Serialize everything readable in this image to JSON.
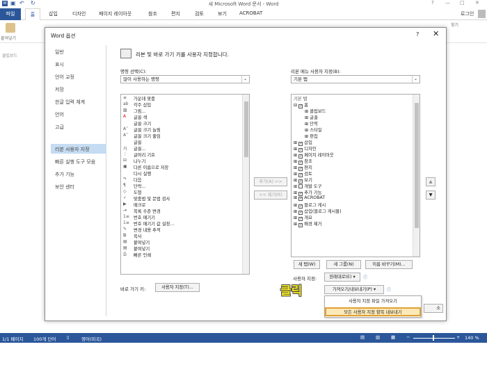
{
  "window": {
    "title": "새 Microsoft Word 문서 - Word",
    "window_controls": [
      "?",
      "—",
      "□",
      "✕"
    ],
    "user": "로그인"
  },
  "ribbon": {
    "tabs": [
      "파일",
      "홈",
      "삽입",
      "디자인",
      "페이지 레이아웃",
      "참조",
      "편지",
      "검토",
      "보기",
      "ACROBAT"
    ],
    "paste": "붙여넣기",
    "clipboard": "클립보드",
    "find": "찾기"
  },
  "dialog": {
    "title": "Word 옵션",
    "help": "?",
    "close": "✕",
    "nav": [
      "일반",
      "표시",
      "언어 교정",
      "저장",
      "한글 입력 체계",
      "언어",
      "고급",
      "리본 사용자 지정",
      "빠른 실행 도구 모음",
      "추가 기능",
      "보안 센터"
    ],
    "selected_nav": "리본 사용자 지정",
    "heading": "리본 및 바로 가기 키를 사용자 지정합니다.",
    "commands_label": "명령 선택(C):",
    "commands_value": "많이 사용하는 명령",
    "ribbon_label": "리본 메뉴 사용자 지정(B):",
    "ribbon_value": "기본 탭",
    "commands": [
      "가운데 맞춤",
      "각주 삽입",
      "그림...",
      "글꼴 색",
      "글꼴 크기",
      "글꼴 크기 늘림",
      "글꼴 크기 줄임",
      "글꼴",
      "글꼴...",
      "글머리 기호",
      "나누기",
      "다른 이름으로 저장",
      "다시 실행",
      "다음",
      "단락...",
      "도형",
      "맞춤법 및 문법 검사",
      "매크로",
      "목록 수준 변경",
      "번호 매기기",
      "번호 매기기 값 설정...",
      "변경 내용 추적",
      "복사",
      "붙여넣기",
      "붙여넣기",
      "빠른 인쇄"
    ],
    "add_button": "추가(A) >>",
    "remove_button": "<< 제거(R)",
    "tree_header": "기본 탭",
    "tree": [
      {
        "label": "홈",
        "indent": 0,
        "check": true,
        "expand": "⊟"
      },
      {
        "label": "클립보드",
        "indent": 2,
        "check": false,
        "expand": "⊞"
      },
      {
        "label": "글꼴",
        "indent": 2,
        "check": false,
        "expand": "⊞"
      },
      {
        "label": "단락",
        "indent": 2,
        "check": false,
        "expand": "⊞"
      },
      {
        "label": "스타일",
        "indent": 2,
        "check": false,
        "expand": "⊞"
      },
      {
        "label": "편집",
        "indent": 2,
        "check": false,
        "expand": "⊞"
      },
      {
        "label": "삽입",
        "indent": 0,
        "check": true,
        "expand": "⊞"
      },
      {
        "label": "디자인",
        "indent": 0,
        "check": true,
        "expand": "⊞"
      },
      {
        "label": "페이지 레이아웃",
        "indent": 0,
        "check": true,
        "expand": "⊞"
      },
      {
        "label": "참조",
        "indent": 0,
        "check": true,
        "expand": "⊞"
      },
      {
        "label": "편지",
        "indent": 0,
        "check": true,
        "expand": "⊞"
      },
      {
        "label": "검토",
        "indent": 0,
        "check": true,
        "expand": "⊞"
      },
      {
        "label": "보기",
        "indent": 0,
        "check": true,
        "expand": "⊞"
      },
      {
        "label": "개발 도구",
        "indent": 0,
        "check": false,
        "expand": "⊞"
      },
      {
        "label": "추가 기능",
        "indent": 0,
        "check": true,
        "expand": "⊞"
      },
      {
        "label": "ACROBAT",
        "indent": 0,
        "check": true,
        "expand": "⊞"
      },
      {
        "label": "블로그 게시",
        "indent": 0,
        "check": true,
        "expand": "⊞"
      },
      {
        "label": "삽입(블로그 게시물)",
        "indent": 0,
        "check": true,
        "expand": "⊞"
      },
      {
        "label": "개요",
        "indent": 0,
        "check": true,
        "expand": "⊞"
      },
      {
        "label": "배경 제거",
        "indent": 0,
        "check": true,
        "expand": "⊞"
      }
    ],
    "new_tab": "새 탭(W)",
    "new_group": "새 그룹(N)",
    "rename": "이름 바꾸기(M)...",
    "custom_label": "사용자 지정:",
    "reset_button": "원래대로(E) ▾",
    "shortcut_label": "바로 가기 키:",
    "shortcut_button": "사용자 지정(T)...",
    "import_export": "가져오기/내보내기(P) ▾",
    "menu": [
      "사용자 지정 파일 가져오기",
      "모든 사용자 지정 항목 내보내기"
    ],
    "cancel_partial": "소",
    "up": "▲",
    "down": "▼"
  },
  "annotation": "클릭",
  "status": {
    "page": "1/1 페이지",
    "words": "100개 단어",
    "lang": "영어(미국)",
    "zoom": "140 %"
  }
}
